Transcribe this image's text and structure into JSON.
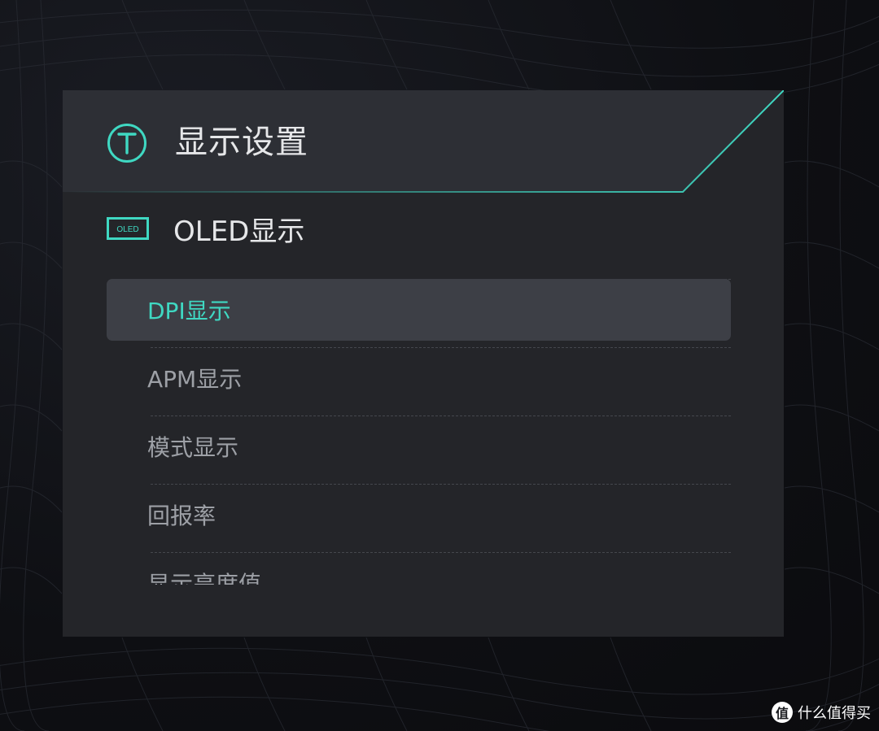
{
  "header": {
    "title": "显示设置",
    "icon": "t-circle-icon"
  },
  "section": {
    "title": "OLED显示",
    "icon": "oled-icon",
    "icon_text": "OLED"
  },
  "menu": {
    "items": [
      {
        "label": "DPI显示",
        "active": true
      },
      {
        "label": "APM显示",
        "active": false
      },
      {
        "label": "模式显示",
        "active": false
      },
      {
        "label": "回报率",
        "active": false
      },
      {
        "label": "显示亮度值",
        "active": false
      }
    ]
  },
  "watermark": {
    "icon_text": "值",
    "text": "什么值得买"
  },
  "colors": {
    "accent": "#3fd8c2",
    "panel": "#242529",
    "header": "#2d2f35",
    "active_row": "#3d3f46",
    "text": "#e6e7e9",
    "muted_text": "#9da0a6"
  }
}
